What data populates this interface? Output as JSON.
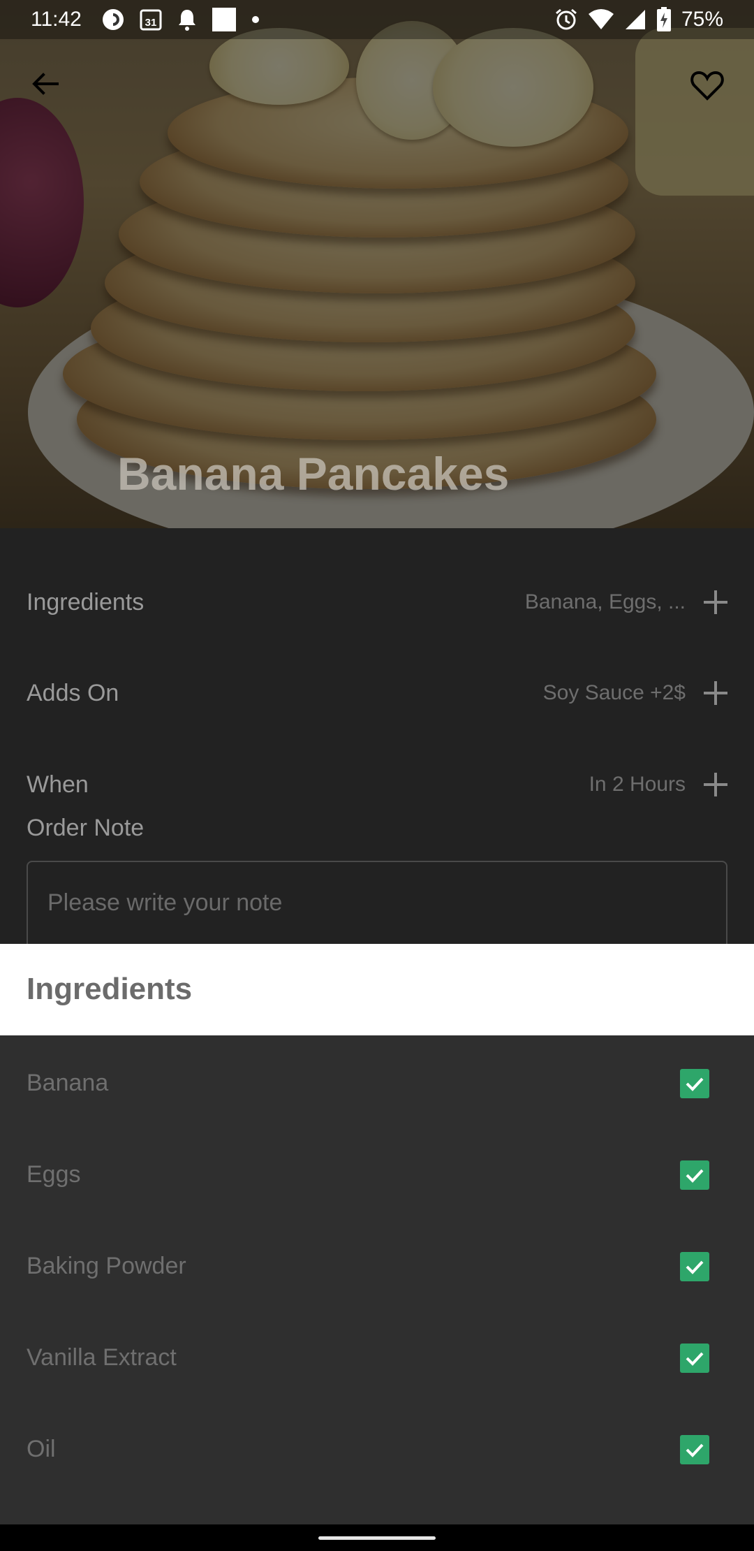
{
  "status_bar": {
    "time": "11:42",
    "calendar_day": "31",
    "battery": "75%",
    "left_icons": [
      "pocket-casts-icon",
      "calendar-icon",
      "notification-bell-icon",
      "square-icon",
      "dot-icon"
    ],
    "right_icons": [
      "alarm-icon",
      "wifi-icon",
      "signal-icon",
      "battery-charging-icon"
    ]
  },
  "header": {
    "back_icon": "arrow-left-icon",
    "favorite_icon": "heart-outline-icon",
    "title": "Banana Pancakes"
  },
  "options": [
    {
      "label": "Ingredients",
      "value": "Banana, Eggs, ..."
    },
    {
      "label": "Adds On",
      "value": "Soy Sauce +2$"
    },
    {
      "label": "When",
      "value": "In 2 Hours"
    }
  ],
  "order_note": {
    "label": "Order Note",
    "placeholder": "Please write your note",
    "value": ""
  },
  "sheet": {
    "title": "Ingredients",
    "items": [
      {
        "label": "Banana",
        "checked": true
      },
      {
        "label": "Eggs",
        "checked": true
      },
      {
        "label": "Baking Powder",
        "checked": true
      },
      {
        "label": "Vanilla Extract",
        "checked": true
      },
      {
        "label": "Oil",
        "checked": true
      }
    ]
  },
  "colors": {
    "check_green": "#2ea66a",
    "details_bg": "#222222",
    "sheet_list_bg": "#2f2f2f"
  }
}
